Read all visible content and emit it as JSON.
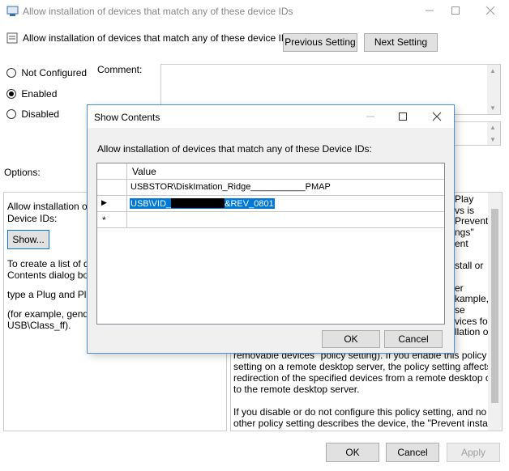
{
  "main_window": {
    "title": "Allow installation of devices that match any of these device IDs",
    "setting_title": "Allow installation of devices that match any of these device IDs",
    "prev_button": "Previous Setting",
    "next_button": "Next Setting",
    "comment_label": "Comment:",
    "options_label": "Options:",
    "radios": [
      {
        "label": "Not Configured",
        "selected": false
      },
      {
        "label": "Enabled",
        "selected": true
      },
      {
        "label": "Disabled",
        "selected": false
      }
    ],
    "options_text_1": "Allow installation of",
    "options_text_2": "Device IDs:",
    "show_button": "Show...",
    "options_text_3": "To create a list of dev",
    "options_text_4": "Contents dialog box,",
    "options_text_5": "type a Plug and Play",
    "options_text_6": "(for example, gendis",
    "options_text_7": "USB\\Class_ff).",
    "help_right_lines": [
      "Play",
      "vs is",
      "Prevent",
      "ngs\"",
      "ent",
      "",
      "stall or",
      "",
      "er",
      "kample,",
      "se",
      "vices for",
      "llation of"
    ],
    "help_bottom_1": "removable devices\" policy setting). If you enable this policy",
    "help_bottom_2": "setting on a remote desktop server, the policy setting affects",
    "help_bottom_3": "redirection of the specified devices from a remote desktop client",
    "help_bottom_4": "to the remote desktop server.",
    "help_bottom_5": "If you disable or do not configure this policy setting, and no",
    "help_bottom_6": "other policy setting describes the device, the \"Prevent installation",
    "ok_button": "OK",
    "cancel_button": "Cancel",
    "apply_button": "Apply"
  },
  "dialog": {
    "title": "Show Contents",
    "prompt": "Allow installation of devices that match any of these Device IDs:",
    "column_header": "Value",
    "rows": [
      {
        "marker": "",
        "value": "USBSTOR\\DiskImation_Ridge___________PMAP"
      },
      {
        "marker": "▶",
        "value_prefix": "USB\\VID_",
        "value_suffix": "&REV_0801"
      },
      {
        "marker": "*",
        "value": ""
      }
    ],
    "ok_button": "OK",
    "cancel_button": "Cancel"
  }
}
